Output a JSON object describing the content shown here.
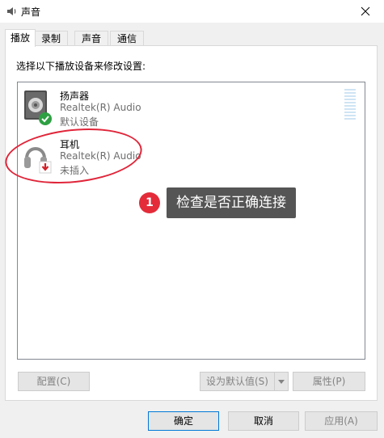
{
  "window": {
    "title": "声音",
    "app_icon": "speaker-icon",
    "close_icon": "close-icon"
  },
  "tabs": [
    {
      "label": "播放",
      "active": true
    },
    {
      "label": "录制",
      "active": false
    },
    {
      "label": "声音",
      "active": false
    },
    {
      "label": "通信",
      "active": false
    }
  ],
  "playback": {
    "instruction": "选择以下播放设备来修改设置:",
    "devices": [
      {
        "name": "扬声器",
        "driver": "Realtek(R) Audio",
        "status": "默认设备",
        "icon": "speaker-device-icon",
        "badge_icon": "default-check-icon",
        "badge_color": "#2ea043"
      },
      {
        "name": "耳机",
        "driver": "Realtek(R) Audio",
        "status": "未插入",
        "icon": "headphones-icon",
        "badge_icon": "unplugged-arrow-icon",
        "badge_color": "#d0222a"
      }
    ]
  },
  "annotation": {
    "step_number": "1",
    "tooltip": "检查是否正确连接",
    "accent_color": "#e42b3a"
  },
  "panel_buttons": {
    "configure": "配置(C)",
    "set_default": "设为默认值(S)",
    "properties": "属性(P)"
  },
  "dialog_buttons": {
    "ok": "确定",
    "cancel": "取消",
    "apply": "应用(A)"
  }
}
